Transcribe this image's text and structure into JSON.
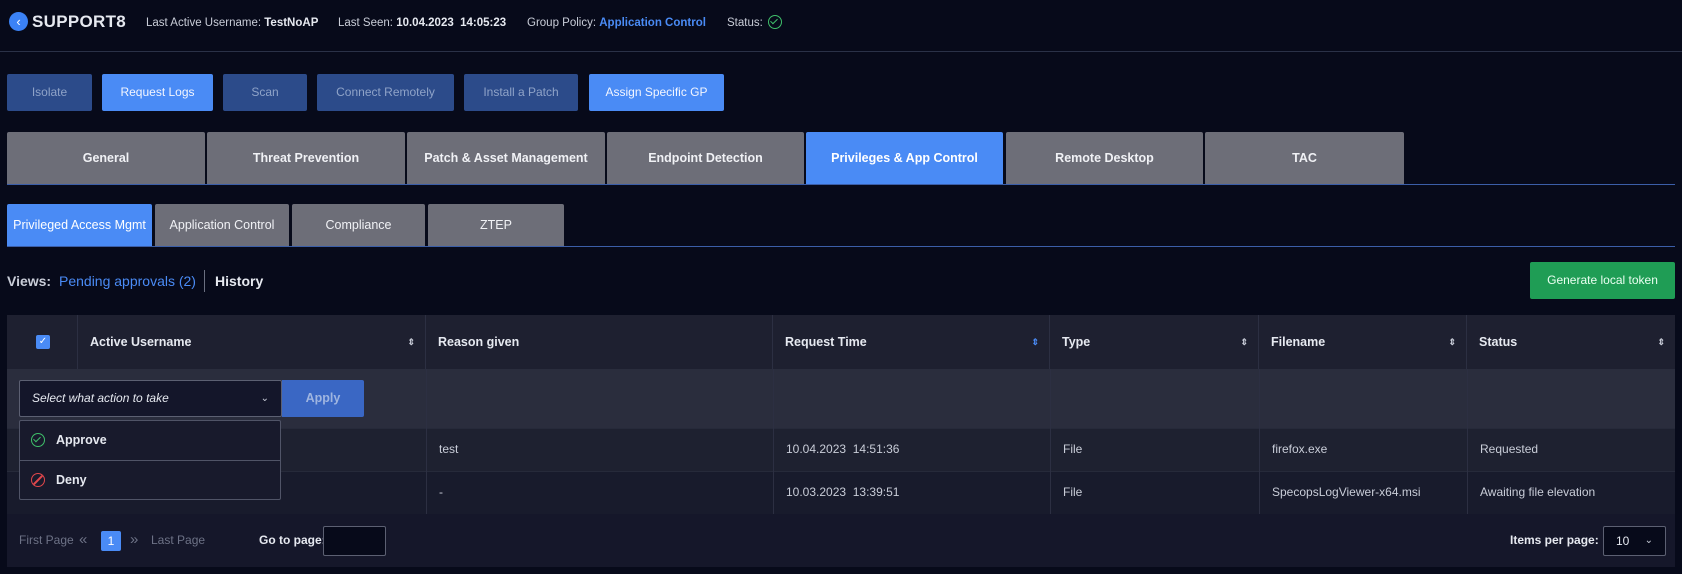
{
  "header": {
    "host": "SUPPORT8",
    "last_user_label": "Last Active Username:",
    "last_user_value": "TestNoAP",
    "last_seen_label": "Last Seen:",
    "last_seen_value": "10.04.2023  14:05:23",
    "group_policy_label": "Group Policy:",
    "group_policy_value": "Application Control",
    "status_label": "Status:"
  },
  "toolbar": {
    "isolate": "Isolate",
    "request_logs": "Request Logs",
    "scan": "Scan",
    "connect_remotely": "Connect Remotely",
    "install_patch": "Install a Patch",
    "assign_gp": "Assign Specific GP"
  },
  "main_tabs": [
    "General",
    "Threat Prevention",
    "Patch & Asset Management",
    "Endpoint Detection",
    "Privileges & App Control",
    "Remote Desktop",
    "TAC"
  ],
  "sub_tabs": [
    "Privileged Access Mgmt",
    "Application Control",
    "Compliance",
    "ZTEP"
  ],
  "views": {
    "label": "Views:",
    "pending": "Pending approvals (2)",
    "history": "History",
    "generate_token": "Generate local token"
  },
  "table": {
    "columns": [
      "Active Username",
      "Reason given",
      "Request Time",
      "Type",
      "Filename",
      "Status"
    ],
    "action_placeholder": "Select what action to take",
    "apply": "Apply",
    "rows": [
      {
        "reason": "test",
        "time": "10.04.2023  14:51:36",
        "type": "File",
        "filename": "firefox.exe",
        "status": "Requested"
      },
      {
        "reason": "-",
        "time": "10.03.2023  13:39:51",
        "type": "File",
        "filename": "SpecopsLogViewer-x64.msi",
        "status": "Awaiting file elevation"
      }
    ]
  },
  "dropdown": {
    "approve": "Approve",
    "deny": "Deny"
  },
  "pagination": {
    "first": "First Page",
    "current": "1",
    "last": "Last Page",
    "goto_label": "Go to page:",
    "ipp_label": "Items per page:",
    "ipp_value": "10"
  },
  "colors": {
    "accent": "#4a8bf5",
    "success": "#1f9d55",
    "danger": "#e0474c",
    "background": "#070a1a"
  }
}
